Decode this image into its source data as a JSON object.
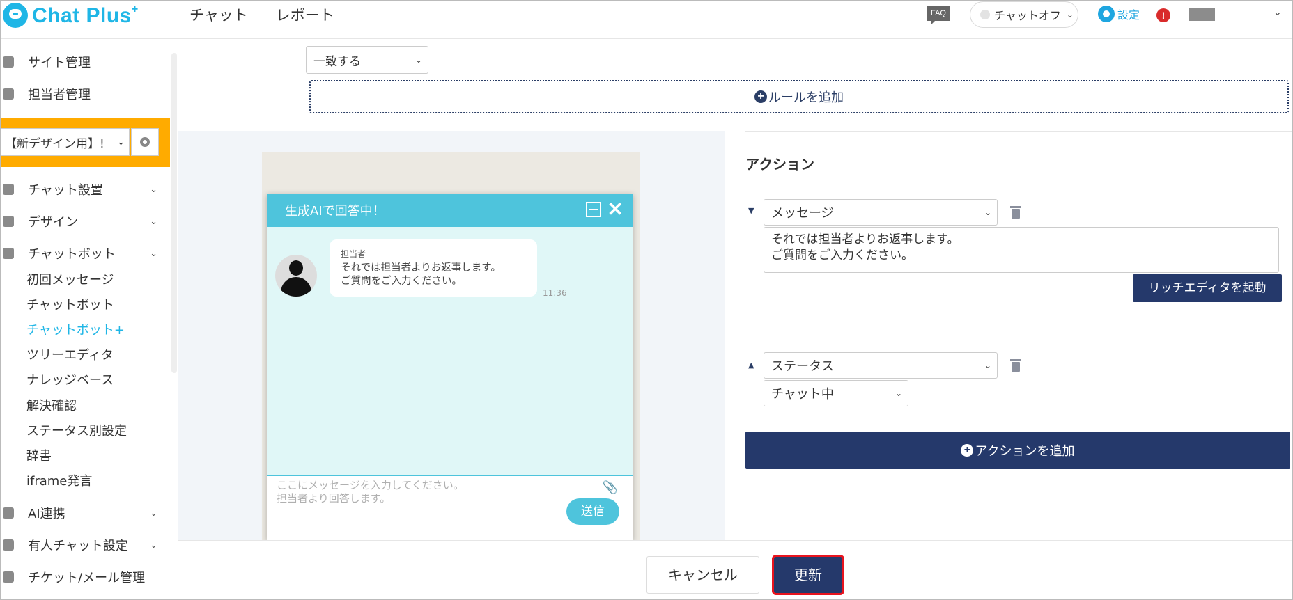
{
  "header": {
    "logo_text": "Chat Plus",
    "logo_sup": "+",
    "nav": [
      "チャット",
      "レポート"
    ],
    "faq": "FAQ",
    "chat_status": "チャットオフ",
    "settings_label": "設定",
    "alert": "!"
  },
  "sidebar": {
    "site_management": "サイト管理",
    "staff_management": "担当者管理",
    "site_select": "【新デザイン用】!",
    "sections": {
      "chat_setup": "チャット設置",
      "design": "デザイン",
      "chatbot": "チャットボット",
      "ai": "AI連携",
      "manned": "有人チャット設定",
      "ticket": "チケット/メール管理"
    },
    "chatbot_items": [
      "初回メッセージ",
      "チャットボット",
      "チャットボット+",
      "ツリーエディタ",
      "ナレッジベース",
      "解決確認",
      "ステータス別設定",
      "辞書",
      "iframe発言"
    ],
    "active_item": "チャットボット+"
  },
  "rules": {
    "match_select": "一致する",
    "add_rule": "ルールを追加"
  },
  "preview": {
    "title": "生成AIで回答中！",
    "sender": "担当者",
    "message_line1": "それでは担当者よりお返事します。",
    "message_line2": "ご質問をご入力ください。",
    "time": "11:36",
    "input_placeholder_line1": "ここにメッセージを入力してください。",
    "input_placeholder_line2": "担当者より回答します。",
    "send": "送信"
  },
  "actions": {
    "title": "アクション",
    "action1_type": "メッセージ",
    "action1_text_line1": "それでは担当者よりお返事します。",
    "action1_text_line2": "ご質問をご入力ください。",
    "rich_editor": "リッチエディタを起動",
    "action2_type": "ステータス",
    "action2_value": "チャット中",
    "add_action": "アクションを追加"
  },
  "footer": {
    "cancel": "キャンセル",
    "update": "更新"
  },
  "colors": {
    "brand": "#1fb6e6",
    "navy": "#25396b",
    "widget": "#4ec4dc",
    "highlight": "#ffab00",
    "danger": "#e8141e"
  }
}
